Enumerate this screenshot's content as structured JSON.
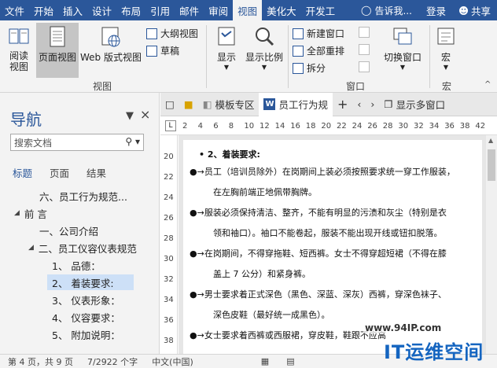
{
  "menu": {
    "tabs": [
      "文件",
      "开始",
      "插入",
      "设计",
      "布局",
      "引用",
      "邮件",
      "审阅",
      "视图",
      "美化大",
      "开发工"
    ],
    "active_tab": "视图",
    "tell_me": "告诉我...",
    "login": "登录",
    "share": "共享"
  },
  "ribbon": {
    "read_view": "阅读视图",
    "page_view": "页面视图",
    "web_view": "Web 版式视图",
    "outline": "大纲视图",
    "draft": "草稿",
    "show": "显示",
    "zoom": "显示比例",
    "new_window": "新建窗口",
    "arrange_all": "全部重排",
    "split": "拆分",
    "switch_window": "切换窗口",
    "macro": "宏",
    "group_view": "视图",
    "group_window": "窗口",
    "group_macro": "宏"
  },
  "nav": {
    "title": "导航",
    "search_placeholder": "搜索文档",
    "tabs": [
      "标题",
      "页面",
      "结果"
    ],
    "active_tab": "标题",
    "tree": [
      {
        "label": "六、员工行为规范...",
        "level": 2,
        "arrow": false
      },
      {
        "label": "前 言",
        "level": 1,
        "arrow": true
      },
      {
        "label": "一、公司介绍",
        "level": 2,
        "arrow": false
      },
      {
        "label": "二、员工仪容仪表规范",
        "level": 2,
        "arrow": true
      },
      {
        "label": "1、  品德：",
        "level": 3,
        "arrow": false
      },
      {
        "label": "2、  着装要求:",
        "level": 3,
        "arrow": false,
        "highlight": true
      },
      {
        "label": "3、  仪表形象：",
        "level": 3,
        "arrow": false
      },
      {
        "label": "4、  仪容要求：",
        "level": 3,
        "arrow": false
      },
      {
        "label": "5、  附加说明：",
        "level": 3,
        "arrow": false
      }
    ]
  },
  "doctabs": {
    "template_zone": "模板专区",
    "doc_name": "员工行为规",
    "show_multi": "显示多窗口"
  },
  "ruler": {
    "h_ticks": [
      "2",
      "4",
      "6",
      "8",
      "10",
      "12",
      "14",
      "16",
      "18",
      "20",
      "22",
      "24",
      "26",
      "28",
      "30",
      "32",
      "34",
      "36",
      "38",
      "42"
    ],
    "v_ticks": [
      "20",
      "22",
      "24",
      "26",
      "28",
      "30",
      "32",
      "34",
      "36",
      "38"
    ]
  },
  "document": {
    "lines": [
      "• 2、着装要求:",
      "●→员工（培训员除外）在岗期间上装必须按照要求统一穿工作服装，",
      "在左胸前端正地佩带胸牌。",
      "●→服装必须保持清洁、整齐，不能有明显的污渍和灰尘（特别是衣",
      "领和袖口）。袖口不能卷起，服装不能出现开线或钮扣脱落。",
      "●→在岗期间，不得穿拖鞋、短西裤。女士不得穿超短裙（不得在膝",
      "盖上 7 公分）和紧身裤。",
      "●→男士要求着正式深色（黑色、深蓝、深灰）西裤，穿深色袜子、",
      "深色皮鞋（最好统一成黑色）。",
      "●→女士要求着西裤或西服裙，穿皮鞋，鞋跟不应高"
    ]
  },
  "status": {
    "page": "第 4 页，共 9 页",
    "words": "7/2922 个字",
    "lang": "中文(中国)"
  },
  "watermark": {
    "url": "www.94IP.com",
    "logo": "IT运维空间"
  },
  "colors": {
    "accent": "#2b579a",
    "highlight": "#cde0f7"
  }
}
